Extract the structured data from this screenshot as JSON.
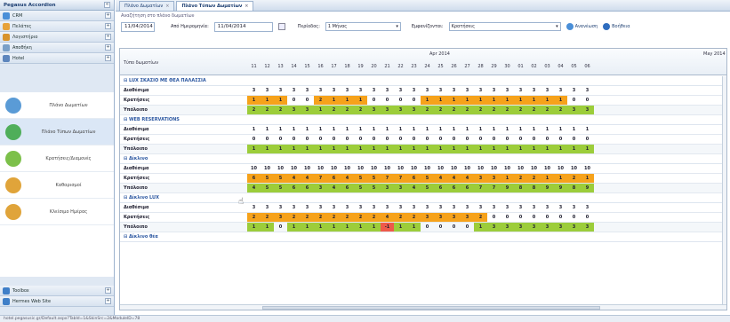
{
  "sidebar": {
    "title": "Pegasus Accordion",
    "items": [
      {
        "label": "CRM",
        "color": "#4a8fd8"
      },
      {
        "label": "Πελάτες",
        "color": "#e7a23a"
      },
      {
        "label": "Λογιστήριο",
        "color": "#d8932c"
      },
      {
        "label": "Αποθήκη",
        "color": "#7aa0c8"
      },
      {
        "label": "Hotel",
        "color": "#5d86bd"
      }
    ],
    "hotel_modules": [
      {
        "label": "Πλάνο Δωματίων",
        "color": "#5a9bd6"
      },
      {
        "label": "Πλάνο Τύπων Δωματίων",
        "color": "#4fae5a"
      },
      {
        "label": "Κρατήσεις/Διαμονές",
        "color": "#7cc04a"
      },
      {
        "label": "Καθαρισμοί",
        "color": "#e0a43a"
      },
      {
        "label": "Κλείσιμο Ημέρας",
        "color": "#e0a43a"
      }
    ],
    "bottom": [
      {
        "label": "Toolbox",
        "color": "#3f7fc8"
      },
      {
        "label": "Hermes Web Site",
        "color": "#3f7fc8"
      }
    ]
  },
  "tabs": [
    {
      "label": "Πλάνο Δωματίων",
      "active": false
    },
    {
      "label": "Πλάνο Τύπων Δωματίων",
      "active": true
    }
  ],
  "search": {
    "title": "Αναζήτηση στο πλάνο δωματίων",
    "date": "11/04/2014",
    "from_label": "Από Ημερομηνία:",
    "from_value": "11/04/2014",
    "period_label": "Περίοδος:",
    "period_value": "1 Μήνας",
    "show_label": "Εμφανίζονται:",
    "show_value": "Κρατήσεις",
    "refresh_label": "Ανανέωση",
    "help_label": "Βοήθεια"
  },
  "grid": {
    "col_label": "Τύπο δωματίων",
    "month1": "Apr 2014",
    "month2": "May 2014",
    "days": [
      "11",
      "12",
      "13",
      "14",
      "15",
      "16",
      "17",
      "18",
      "19",
      "20",
      "21",
      "22",
      "23",
      "24",
      "25",
      "26",
      "27",
      "28",
      "29",
      "30",
      "01",
      "02",
      "03",
      "04",
      "05",
      "06"
    ],
    "groups": [
      {
        "name": "LUX ΣΚΑΣΙΟ ΜΕ ΘΕΑ ΠΑΛΑΣΣΙΑ",
        "rows": [
          {
            "label": "Διαθέσιμα",
            "cls": "n",
            "values": [
              "3",
              "3",
              "3",
              "3",
              "3",
              "3",
              "3",
              "3",
              "3",
              "3",
              "3",
              "3",
              "3",
              "3",
              "3",
              "3",
              "3",
              "3",
              "3",
              "3",
              "3",
              "3",
              "3",
              "3",
              "3",
              "3"
            ]
          },
          {
            "label": "Κρατήσεις",
            "cls": "mix-a",
            "values": [
              "1",
              "1",
              "1",
              "0",
              "0",
              "2",
              "1",
              "1",
              "1",
              "0",
              "0",
              "0",
              "0",
              "1",
              "1",
              "1",
              "1",
              "1",
              "1",
              "1",
              "1",
              "1",
              "1",
              "1",
              "0",
              "0"
            ]
          },
          {
            "label": "Υπόλοιπο",
            "cls": "g",
            "values": [
              "2",
              "2",
              "2",
              "3",
              "3",
              "1",
              "2",
              "2",
              "2",
              "3",
              "3",
              "3",
              "3",
              "2",
              "2",
              "2",
              "2",
              "2",
              "2",
              "2",
              "2",
              "2",
              "2",
              "2",
              "3",
              "3"
            ]
          }
        ]
      },
      {
        "name": "WEB RESERVATIONS",
        "rows": [
          {
            "label": "Διαθέσιμα",
            "cls": "n",
            "values": [
              "1",
              "1",
              "1",
              "1",
              "1",
              "1",
              "1",
              "1",
              "1",
              "1",
              "1",
              "1",
              "1",
              "1",
              "1",
              "1",
              "1",
              "1",
              "1",
              "1",
              "1",
              "1",
              "1",
              "1",
              "1",
              "1"
            ]
          },
          {
            "label": "Κρατήσεις",
            "cls": "n",
            "values": [
              "0",
              "0",
              "0",
              "0",
              "0",
              "0",
              "0",
              "0",
              "0",
              "0",
              "0",
              "0",
              "0",
              "0",
              "0",
              "0",
              "0",
              "0",
              "0",
              "0",
              "0",
              "0",
              "0",
              "0",
              "0",
              "0"
            ]
          },
          {
            "label": "Υπόλοιπο",
            "cls": "g",
            "values": [
              "1",
              "1",
              "1",
              "1",
              "1",
              "1",
              "1",
              "1",
              "1",
              "1",
              "1",
              "1",
              "1",
              "1",
              "1",
              "1",
              "1",
              "1",
              "1",
              "1",
              "1",
              "1",
              "1",
              "1",
              "1",
              "1"
            ]
          }
        ]
      },
      {
        "name": "Δίκλινο",
        "rows": [
          {
            "label": "Διαθέσιμα",
            "cls": "n",
            "values": [
              "10",
              "10",
              "10",
              "10",
              "10",
              "10",
              "10",
              "10",
              "10",
              "10",
              "10",
              "10",
              "10",
              "10",
              "10",
              "10",
              "10",
              "10",
              "10",
              "10",
              "10",
              "10",
              "10",
              "10",
              "10",
              "10"
            ]
          },
          {
            "label": "Κρατήσεις",
            "cls": "o",
            "values": [
              "6",
              "5",
              "5",
              "4",
              "4",
              "7",
              "6",
              "4",
              "5",
              "5",
              "7",
              "7",
              "6",
              "5",
              "4",
              "4",
              "4",
              "3",
              "3",
              "1",
              "2",
              "2",
              "1",
              "1",
              "2",
              "1"
            ]
          },
          {
            "label": "Υπόλοιπο",
            "cls": "g",
            "values": [
              "4",
              "5",
              "5",
              "6",
              "6",
              "3",
              "4",
              "6",
              "5",
              "5",
              "3",
              "3",
              "4",
              "5",
              "6",
              "6",
              "6",
              "7",
              "7",
              "9",
              "8",
              "8",
              "9",
              "9",
              "8",
              "9"
            ]
          }
        ]
      },
      {
        "name": "Δίκλινο LUX",
        "rows": [
          {
            "label": "Διαθέσιμα",
            "cls": "n",
            "values": [
              "3",
              "3",
              "3",
              "3",
              "3",
              "3",
              "3",
              "3",
              "3",
              "3",
              "3",
              "3",
              "3",
              "3",
              "3",
              "3",
              "3",
              "3",
              "3",
              "3",
              "3",
              "3",
              "3",
              "3",
              "3",
              "3"
            ]
          },
          {
            "label": "Κρατήσεις",
            "cls": "mix-b",
            "values": [
              "2",
              "2",
              "3",
              "2",
              "2",
              "2",
              "2",
              "2",
              "2",
              "2",
              "4",
              "2",
              "2",
              "3",
              "3",
              "3",
              "3",
              "2",
              "0",
              "0",
              "0",
              "0",
              "0",
              "0",
              "0",
              "0"
            ]
          },
          {
            "label": "Υπόλοιπο",
            "cls": "mix-c",
            "values": [
              "1",
              "1",
              "0",
              "1",
              "1",
              "1",
              "1",
              "1",
              "1",
              "1",
              "-1",
              "1",
              "1",
              "0",
              "0",
              "0",
              "0",
              "1",
              "3",
              "3",
              "3",
              "3",
              "3",
              "3",
              "3",
              "3"
            ]
          }
        ]
      },
      {
        "name": "Δίκλινο θέα",
        "rows": []
      }
    ]
  },
  "statusbar": "hotel.pegasusic.gr/Default.aspx?TabId=1&SkinSrc=2&ModuleID=78"
}
